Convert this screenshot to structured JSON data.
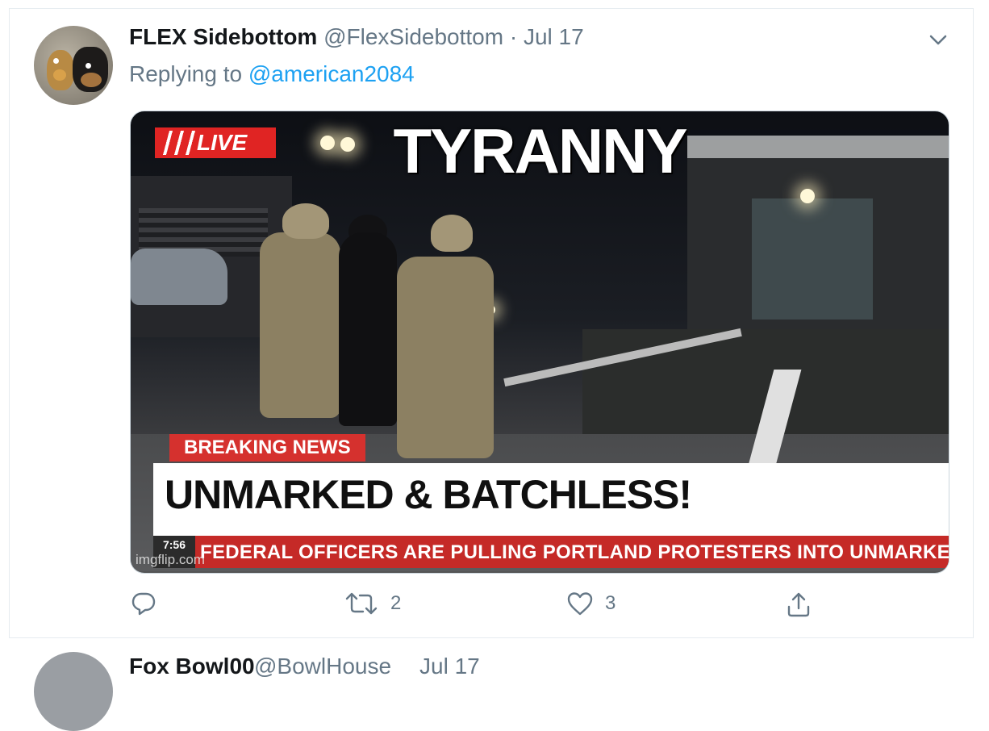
{
  "tweet": {
    "author_name": "FLEX Sidebottom",
    "author_handle": "@FlexSidebottom",
    "separator": "·",
    "date": "Jul 17",
    "replying_to_prefix": "Replying to",
    "replying_to_handle": "@american2084",
    "image": {
      "live_label": "LIVE",
      "headline": "TYRANNY",
      "breaking_label": "BREAKING NEWS",
      "lower_third": "UNMARKED & BATCHLESS!",
      "ticker": "FEDERAL OFFICERS ARE PULLING PORTLAND PROTESTERS INTO UNMARKE",
      "clock": "7:56",
      "watermark": "imgflip.com"
    },
    "actions": {
      "reply_icon": "reply-icon",
      "retweet_icon": "retweet-icon",
      "retweet_count": "2",
      "like_icon": "like-icon",
      "like_count": "3",
      "share_icon": "share-icon"
    }
  },
  "next_tweet": {
    "author_name": "Fox Bowl00",
    "author_handle": "@BowlHouse",
    "date": "Jul 17"
  },
  "colors": {
    "link": "#1da1f2",
    "secondary_text": "#657786",
    "border": "#e6ecf0",
    "breaking_red": "#d5312e"
  }
}
